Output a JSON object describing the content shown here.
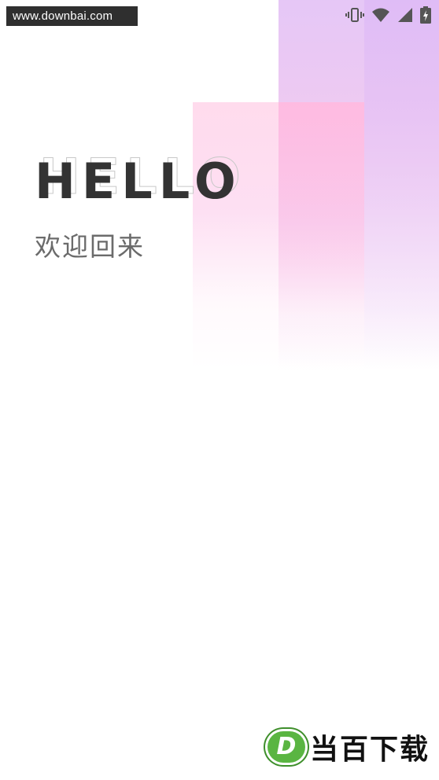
{
  "watermark": {
    "text": "www.downbai.com"
  },
  "status_bar": {
    "icons": [
      "vibrate-icon",
      "wifi-icon",
      "signal-icon",
      "battery-charging-icon"
    ]
  },
  "welcome": {
    "heading": "HELLO",
    "subtitle": "欢迎回来"
  },
  "brand": {
    "badge_letter": "D",
    "name": "当百下载"
  },
  "colors": {
    "heading": "#333333",
    "subtitle": "#6b6b6b",
    "panel_purple": "#e4c4f6",
    "panel_pink": "#ffd2e8",
    "brand_green": "#5ab542"
  }
}
